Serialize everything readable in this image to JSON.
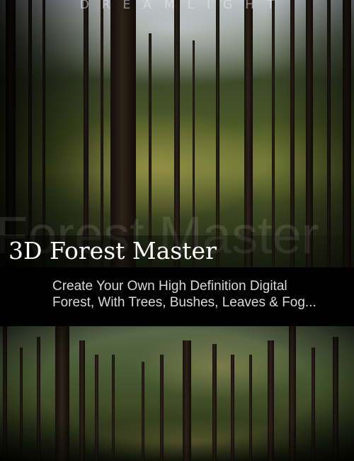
{
  "cover": {
    "brand": "DREAMLIGHT",
    "watermark": "Forest Master",
    "title": "3D Forest Master",
    "subtitle_lines": [
      "Create Your Own High Definition Digital",
      "Forest, With Trees, Bushes, Leaves & Fog..."
    ]
  },
  "colors": {
    "background": "#000000",
    "title": "#ffffff",
    "subtitle": "#d9d9d9"
  },
  "images": {
    "top": "forest-photo",
    "bottom": "forest-photo"
  }
}
